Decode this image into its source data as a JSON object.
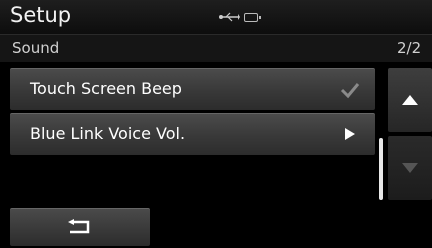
{
  "header": {
    "title": "Setup",
    "icons": [
      "usb-icon",
      "battery-icon"
    ]
  },
  "subheader": {
    "section": "Sound",
    "page": "2/2"
  },
  "list": {
    "items": [
      {
        "label": "Touch Screen Beep",
        "control": "check-icon",
        "checked": true
      },
      {
        "label": "Blue Link Voice Vol.",
        "control": "play-arrow-icon"
      }
    ]
  },
  "scroll": {
    "up_icon": "triangle-up-icon",
    "down_icon": "triangle-down-icon",
    "down_enabled": false
  },
  "footer": {
    "back_icon": "return-arrow-icon"
  },
  "colors": {
    "background": "#000000",
    "button": "#3a3a3a",
    "text": "#ffffff"
  }
}
